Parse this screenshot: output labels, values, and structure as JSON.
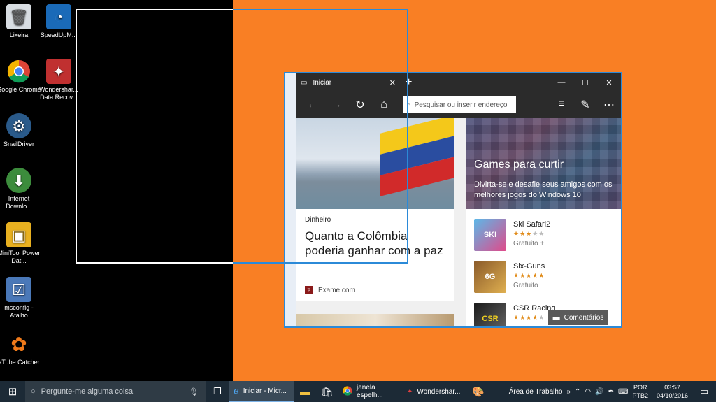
{
  "desktop": {
    "icons": [
      {
        "label": "Lixeira",
        "icon": "recycle-bin-icon"
      },
      {
        "label": "Google Chrome",
        "icon": "chrome-icon"
      },
      {
        "label": "SnailDriver",
        "icon": "gear-icon"
      },
      {
        "label": "Internet Downlo...",
        "icon": "download-globe-icon"
      },
      {
        "label": "MiniTool Power Dat...",
        "icon": "minitool-icon"
      },
      {
        "label": "msconfig - Atalho",
        "icon": "msconfig-icon"
      },
      {
        "label": "aTube Catcher",
        "icon": "atube-icon"
      },
      {
        "label": "SpeedUpM...",
        "icon": "speedometer-icon"
      },
      {
        "label": "Wondershar... Data Recov...",
        "icon": "wondershare-icon"
      }
    ]
  },
  "edge": {
    "tab_title": "Iniciar",
    "address_placeholder": "Pesquisar ou inserir endereço",
    "news": {
      "category": "Dinheiro",
      "headline": "Quanto a Colômbia poderia ganhar com a paz",
      "source": "Exame.com",
      "source_badge": "E"
    },
    "games": {
      "title": "Games para curtir",
      "subtitle": "Divirta-se e desafie seus amigos com os melhores jogos do Windows 10",
      "items": [
        {
          "name": "Ski Safari2",
          "rating": 3,
          "price": "Gratuito +",
          "thumb_label": "SKI"
        },
        {
          "name": "Six-Guns",
          "rating": 5,
          "price": "Gratuito",
          "thumb_label": "6G"
        },
        {
          "name": "CSR Racing",
          "rating": 4,
          "price": "",
          "thumb_label": "CSR"
        }
      ]
    },
    "comments_label": "Comentários"
  },
  "taskbar": {
    "search_placeholder": "Pergunte-me alguma coisa",
    "items": [
      {
        "label": "Iniciar - Micr...",
        "icon": "edge-icon",
        "active": true
      },
      {
        "label": "",
        "icon": "folder-icon"
      },
      {
        "label": "",
        "icon": "store-icon"
      },
      {
        "label": "janela espelh...",
        "icon": "chrome-icon"
      },
      {
        "label": "Wondershar...",
        "icon": "wondershare-icon"
      },
      {
        "label": "",
        "icon": "paint-icon"
      }
    ],
    "desktop_label": "Área de Trabalho",
    "language": {
      "top": "POR",
      "bottom": "PTB2"
    },
    "clock": {
      "time": "03:57",
      "date": "04/10/2016"
    }
  },
  "colors": {
    "orange_bg": "#f97f24",
    "accent_blue": "#2b8ad8",
    "taskbar": "#1c2a36"
  }
}
